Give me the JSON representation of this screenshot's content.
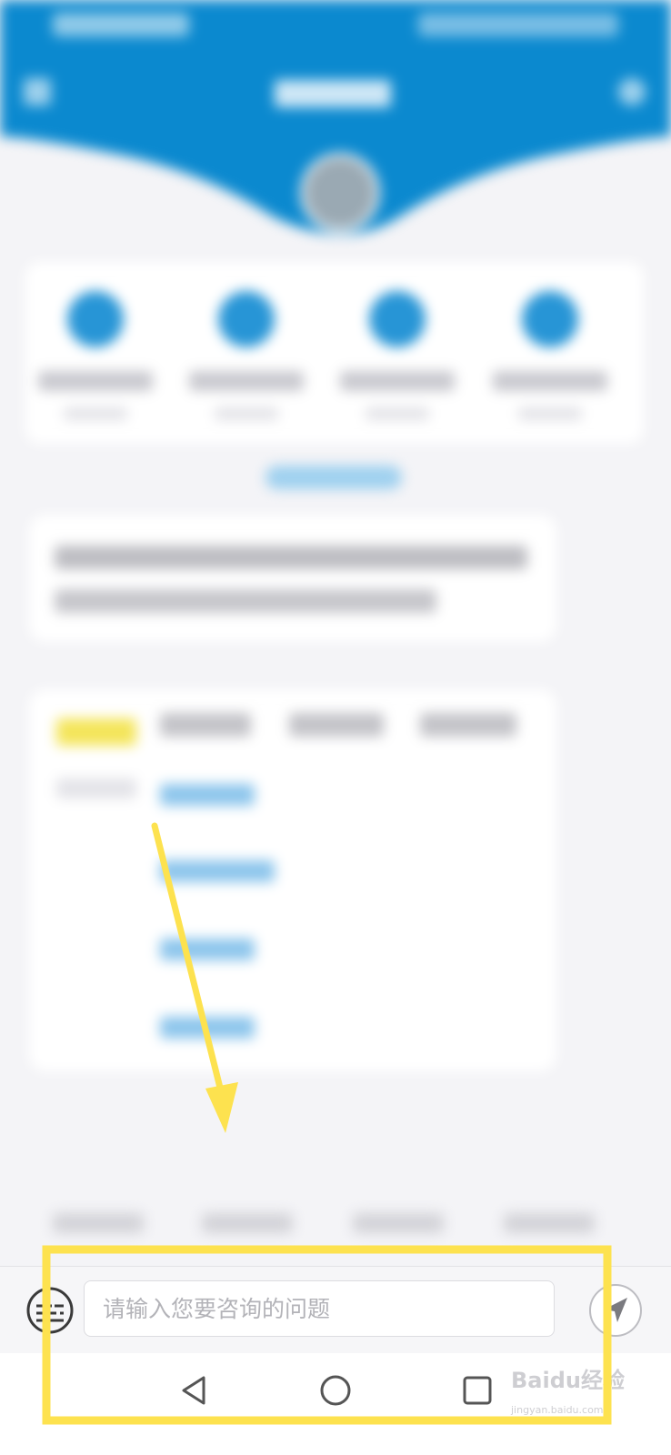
{
  "input_bar": {
    "placeholder": "请输入您要咨询的问题",
    "value": ""
  },
  "icons": {
    "keyboard_toggle": "keyboard-icon",
    "send": "send-arrow-icon",
    "nav_back": "triangle-back-icon",
    "nav_home": "circle-home-icon",
    "nav_recents": "square-recents-icon"
  },
  "colors": {
    "header_blue": "#0b89cf",
    "accent_blue": "#2795d6",
    "annotation_yellow": "#fde24f",
    "page_background": "#f4f4f7"
  },
  "watermark": {
    "brand": "Baidu经验",
    "sub": "jingyan.baidu.com"
  }
}
